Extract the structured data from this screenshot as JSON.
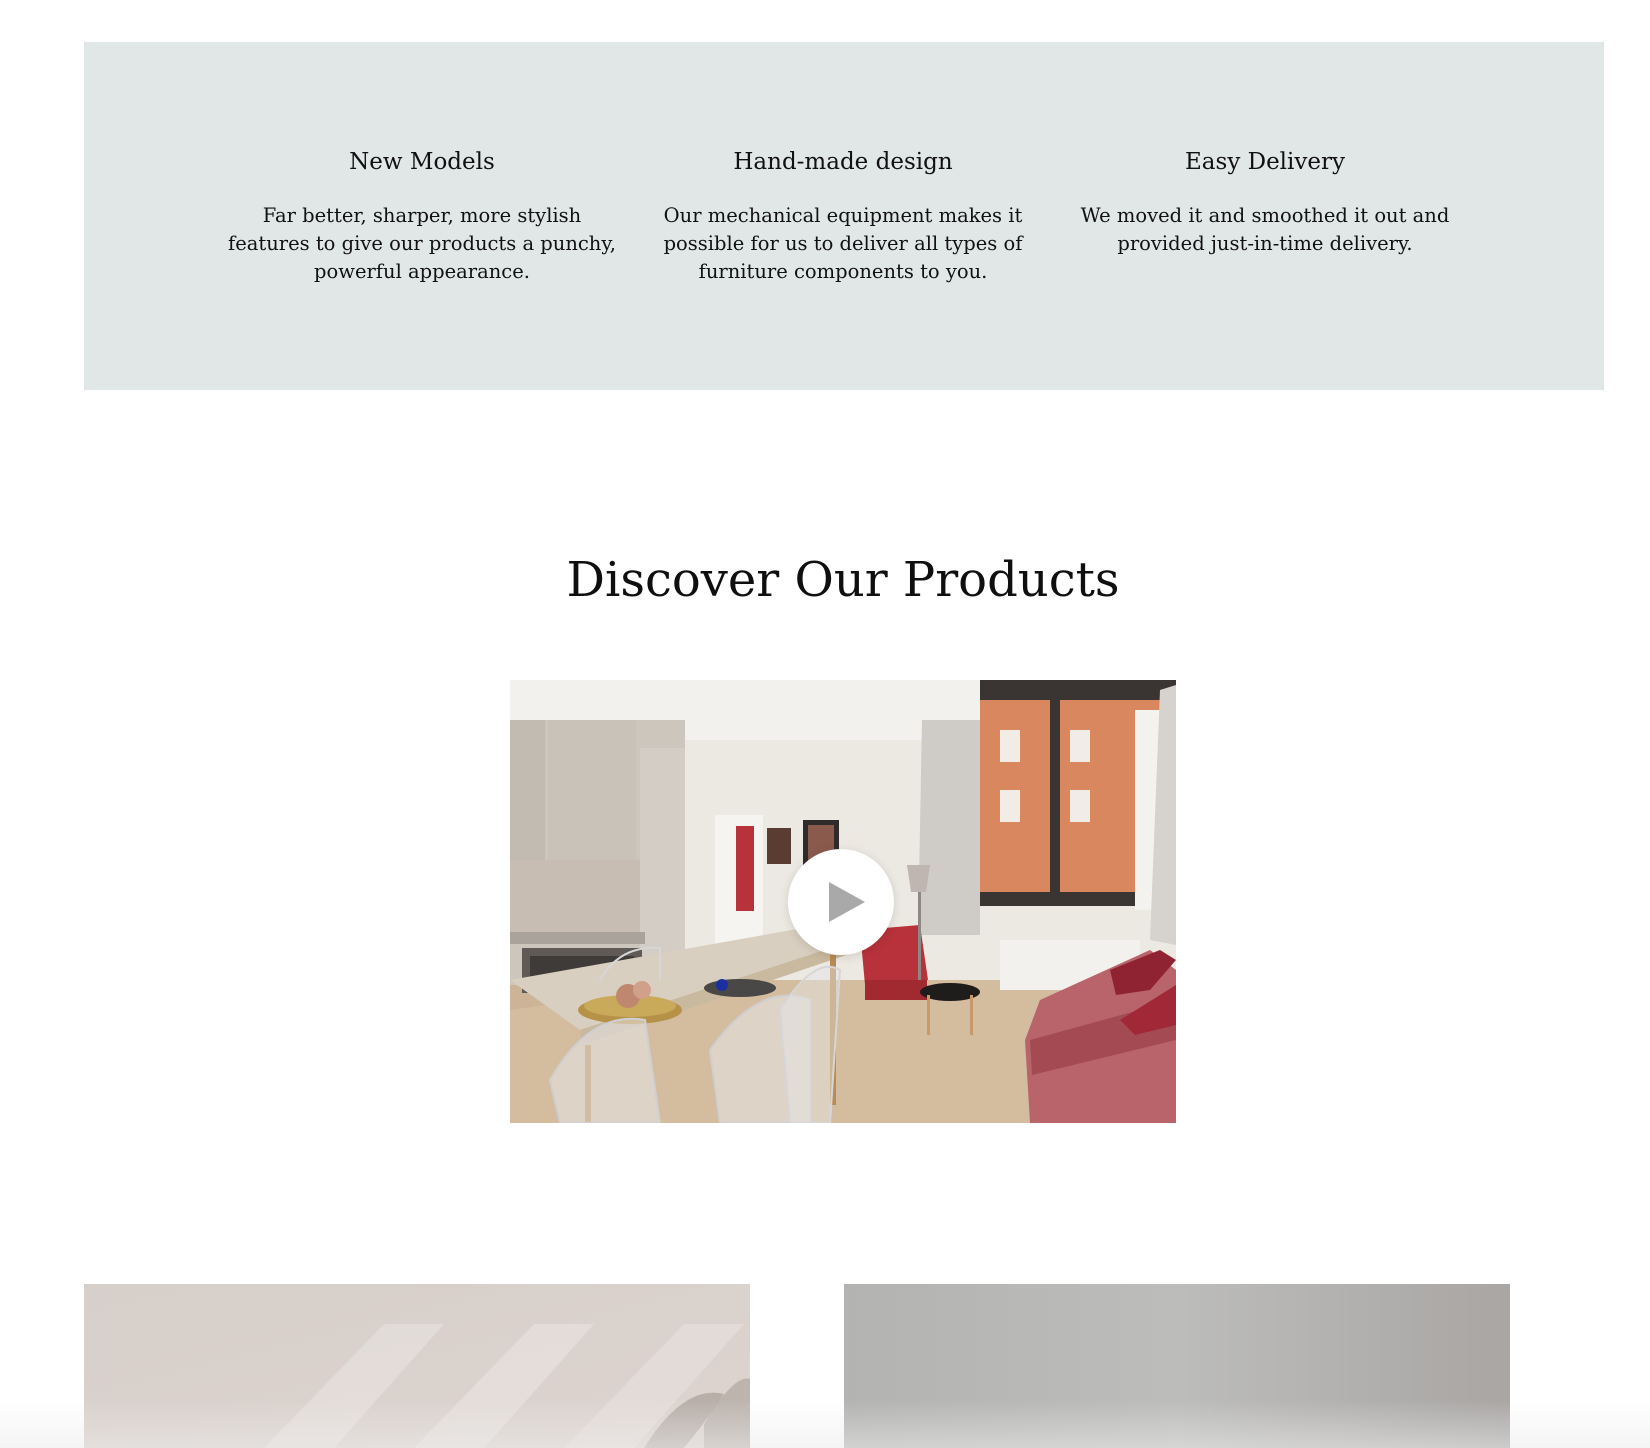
{
  "features": [
    {
      "title": "New Models",
      "description": "Far better, sharper, more stylish features to give our products a punchy, powerful appearance."
    },
    {
      "title": "Hand-made design",
      "description": "Our mechanical equipment makes it possible for us to deliver all types of furniture components to you."
    },
    {
      "title": "Easy Delivery",
      "description": "We moved it and smoothed it out and provided just-in-time delivery."
    }
  ],
  "products": {
    "title": "Discover Our Products",
    "video": {
      "icon": "play-icon"
    }
  },
  "colors": {
    "feature_background": "#e1e6e6",
    "text": "#111111",
    "play_button": "#ffffff",
    "play_icon": "#a9a9a9"
  }
}
